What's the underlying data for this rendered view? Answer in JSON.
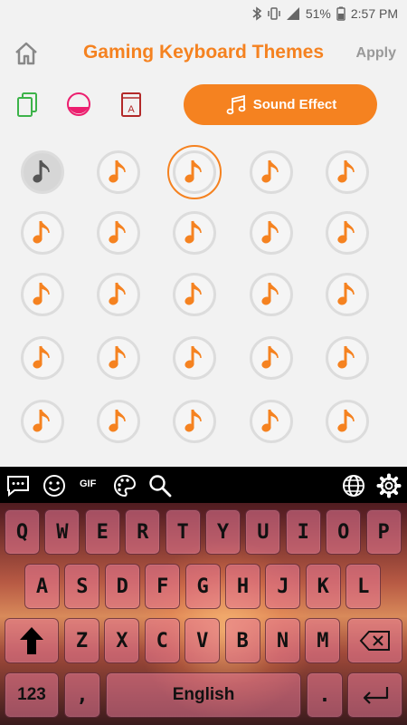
{
  "status": {
    "battery": "51%",
    "time": "2:57 PM"
  },
  "header": {
    "title": "Gaming Keyboard Themes",
    "apply_label": "Apply"
  },
  "toolbar": {
    "sound_effect_label": "Sound Effect"
  },
  "sound_grid": {
    "rows": 5,
    "columns": 5,
    "selected_index": 2,
    "first_item_style": "gray",
    "accent_color": "#f58220"
  },
  "keyboard": {
    "gif_label": "GIF",
    "row1": [
      "Q",
      "W",
      "E",
      "R",
      "T",
      "Y",
      "U",
      "I",
      "O",
      "P"
    ],
    "row2": [
      "A",
      "S",
      "D",
      "F",
      "G",
      "H",
      "J",
      "K",
      "L"
    ],
    "row3": [
      "Z",
      "X",
      "C",
      "V",
      "B",
      "N",
      "M"
    ],
    "numbers_label": "123",
    "comma_label": ",",
    "space_label": "English",
    "period_label": "."
  }
}
